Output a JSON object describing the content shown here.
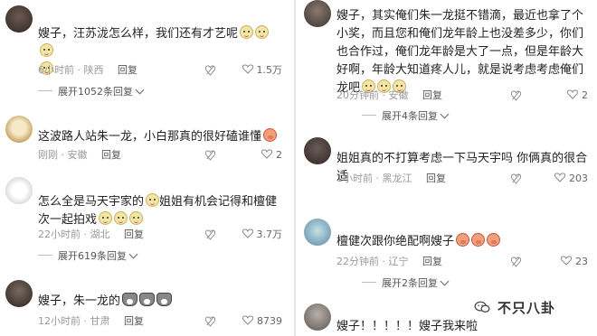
{
  "left": {
    "comments": [
      {
        "text": "嫂子，汪苏泷怎么样，我们还有才艺呢",
        "text_emojis": [
          "sheep",
          "sheep",
          "sheep",
          "sheep"
        ],
        "time": "6小时前",
        "location": "陕西",
        "reply": "回复",
        "likes": "1.5万",
        "expand": "展开1052条回复"
      },
      {
        "text": "这波路人站朱一龙，小白那真的很好磕谁懂",
        "text_emojis": [
          "pig"
        ],
        "time": "刚刚",
        "location": "安徽",
        "reply": "回复",
        "likes": "2"
      },
      {
        "text_a": "怎么全是马天宇家的",
        "text_b": "姐姐有机会记得和檀健次一起拍戏",
        "text_emojis": [
          "sheep",
          "sheep",
          "sheep"
        ],
        "time": "22小时前",
        "location": "湖北",
        "reply": "回复",
        "likes": "3.7万",
        "expand": "展开619条回复"
      },
      {
        "text": "嫂子，朱一龙的",
        "text_emojis": [
          "dog",
          "dog",
          "dog"
        ],
        "time": "12小时前",
        "location": "甘肃",
        "reply": "回复",
        "likes": "8739"
      }
    ]
  },
  "right": {
    "comments": [
      {
        "text": "嫂子，其实俺们朱一龙挺不错滴，最近也拿了个小奖，而且您和俺们龙年龄上也没差多少，你们也合作过，俺们龙年龄是大了一点，但是年龄大好啊，年龄大知道疼人儿，就是说考虑考虑俺们龙吧",
        "text_emojis": [
          "sheep",
          "sheep",
          "sheep"
        ],
        "time": "20分钟前",
        "location": "安徽",
        "reply": "回复",
        "likes": "2",
        "expand": "展开4条回复"
      },
      {
        "text": "姐姐真的不打算考虑一下马天宇吗 你俩真的很合适",
        "time": "1小时前",
        "location": "黑龙江",
        "reply": "回复",
        "likes": "203"
      },
      {
        "text": "檀健次跟你绝配啊嫂子",
        "text_emojis": [
          "pig",
          "pig",
          "pig"
        ],
        "time": "22分钟前",
        "location": "辽宁",
        "reply": "回复",
        "likes": "23",
        "expand": "展开2条回复"
      },
      {
        "text": "嫂子！！！！！嫂子我来啦"
      }
    ]
  },
  "watermark": "不只八卦",
  "colors": {
    "meta": "#9a9a9a",
    "text": "#222222"
  }
}
